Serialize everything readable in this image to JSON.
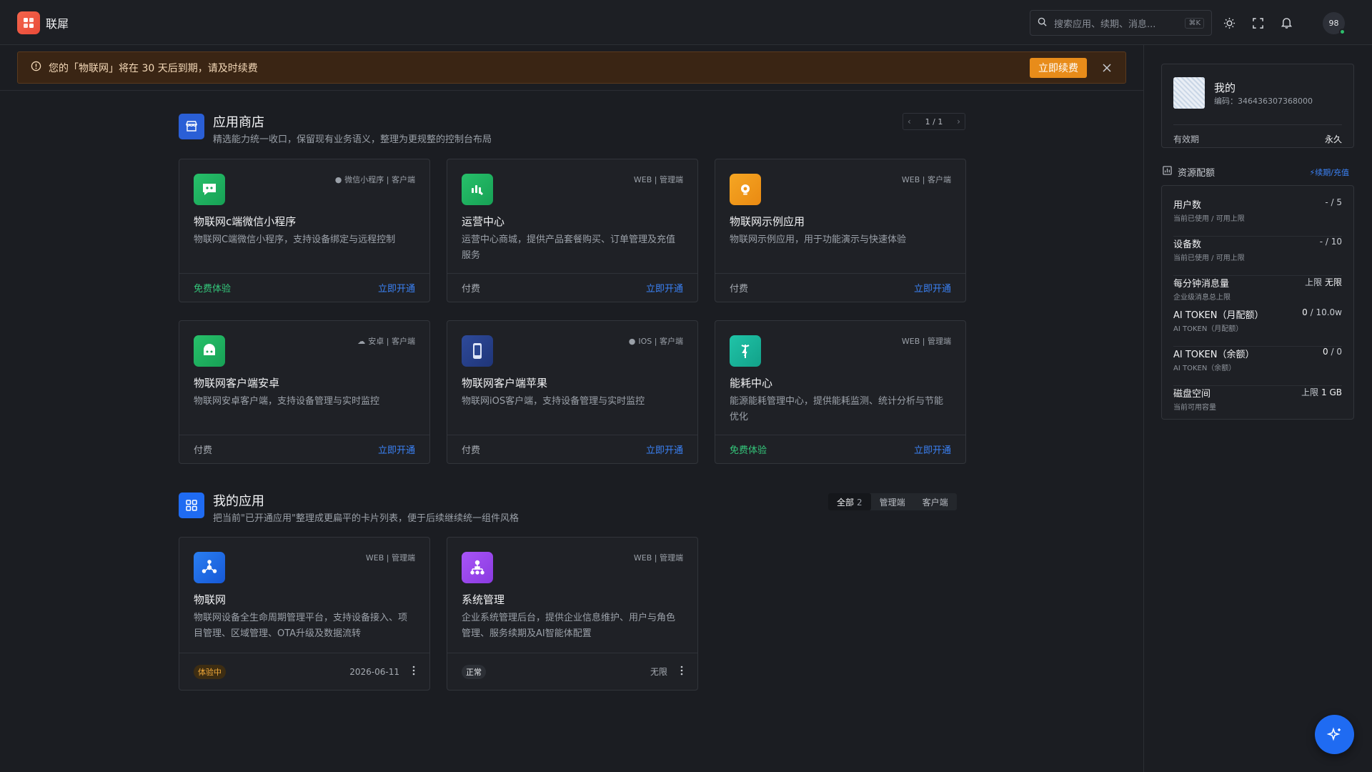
{
  "header": {
    "brand": "联犀",
    "search_placeholder": "搜索应用、续期、消息...",
    "search_shortcut": "⌘K",
    "avatar_text": "98"
  },
  "alert": {
    "text": "您的「物联网」将在 30 天后到期，请及时续费",
    "renew_label": "立即续费"
  },
  "store": {
    "title": "应用商店",
    "subtitle": "精选能力统一收口，保留现有业务语义，整理为更规整的控制台布局",
    "pager": "1 / 1",
    "cards": [
      {
        "name": "物联网c端微信小程序",
        "tag": "微信小程序 | 客户端",
        "desc": "物联网C端微信小程序，支持设备绑定与远程控制",
        "price": "免费体验",
        "action": "立即开通"
      },
      {
        "name": "运营中心",
        "tag": "WEB | 管理端",
        "desc": "运营中心商城，提供产品套餐购买、订单管理及充值服务",
        "price": "付费",
        "action": "立即开通"
      },
      {
        "name": "物联网示例应用",
        "tag": "WEB | 客户端",
        "desc": "物联网示例应用，用于功能演示与快速体验",
        "price": "付费",
        "action": "立即开通"
      },
      {
        "name": "物联网客户端安卓",
        "tag": "安卓 | 客户端",
        "desc": "物联网安卓客户端，支持设备管理与实时监控",
        "price": "付费",
        "action": "立即开通"
      },
      {
        "name": "物联网客户端苹果",
        "tag": "IOS | 客户端",
        "desc": "物联网iOS客户端，支持设备管理与实时监控",
        "price": "付费",
        "action": "立即开通"
      },
      {
        "name": "能耗中心",
        "tag": "WEB | 管理端",
        "desc": "能源能耗管理中心，提供能耗监测、统计分析与节能优化",
        "price": "免费体验",
        "action": "立即开通"
      }
    ]
  },
  "myapps": {
    "title": "我的应用",
    "subtitle": "把当前\"已开通应用\"整理成更扁平的卡片列表，便于后续继续统一组件风格",
    "filters": [
      {
        "label": "全部",
        "count": "2"
      },
      {
        "label": "管理端"
      },
      {
        "label": "客户端"
      }
    ],
    "cards": [
      {
        "name": "物联网",
        "tag": "WEB | 管理端",
        "desc": "物联网设备全生命周期管理平台，支持设备接入、项目管理、区域管理、OTA升级及数据流转",
        "status": "体验中",
        "expire": "2026-06-11"
      },
      {
        "name": "系统管理",
        "tag": "WEB | 管理端",
        "desc": "企业系统管理后台，提供企业信息维护、用户与角色管理、服务续期及AI智能体配置",
        "status": "正常",
        "expire": "无限"
      }
    ]
  },
  "profile": {
    "name": "我的",
    "code": "编码：346436307368000",
    "valid_label": "有效期",
    "valid_value": "永久"
  },
  "resources": {
    "title": "资源配额",
    "link": "续期/充值",
    "rows": [
      {
        "name": "用户数",
        "sub": "当前已使用 / 可用上限",
        "value": "- / 5"
      },
      {
        "name": "设备数",
        "sub": "当前已使用 / 可用上限",
        "value": "- / 10"
      },
      {
        "name": "每分钟消息量",
        "sub": "企业级消息总上限",
        "value_prefix": "上限",
        "value": "无限"
      },
      {
        "name": "AI TOKEN（月配额）",
        "sub": "AI TOKEN（月配额）",
        "value_main": "0",
        "value": "/ 10.0w"
      },
      {
        "name": "AI TOKEN（余额）",
        "sub": "AI TOKEN（余额）",
        "value_main": "0",
        "value": "/ 0"
      },
      {
        "name": "磁盘空间",
        "sub": "当前可用容量",
        "value_prefix": "上限",
        "value": "1 GB"
      }
    ]
  },
  "colors": {
    "accent": "#3b82f6",
    "free": "#34c77b",
    "warning": "#e88c1a"
  }
}
